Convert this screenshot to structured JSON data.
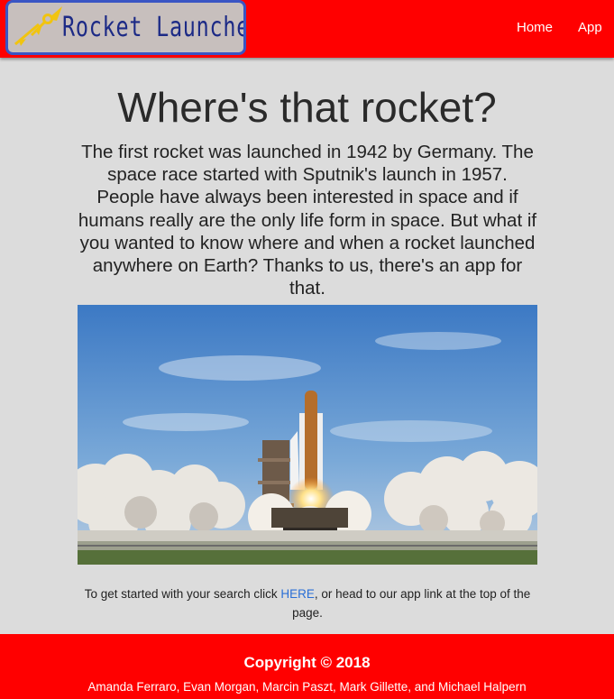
{
  "nav": {
    "logo_text": "Rocket Launcher",
    "logo_icon": "rocket-icon",
    "links": [
      {
        "label": "Home"
      },
      {
        "label": "App"
      }
    ]
  },
  "main": {
    "title": "Where's that rocket?",
    "intro": "The first rocket was launched in 1942 by Germany. The space race started with Sputnik's launch in 1957. People have always been interested in space and if humans really are the only life form in space. But what if you wanted to know where and when a rocket launched anywhere on Earth? Thanks to us, there's an app for that.",
    "image": "space-shuttle-launch-photo",
    "cta": {
      "before": "To get started with your search click ",
      "link": "HERE",
      "after": ", or head to our app link at the top of the page."
    }
  },
  "footer": {
    "copyright": "Copyright © 2018",
    "authors": "Amanda Ferraro, Evan Morgan, Marcin Paszt, Mark Gillette, and Michael Halpern"
  },
  "colors": {
    "brand": "#ff0000",
    "background": "#dcdcdc",
    "link": "#2a6fd6",
    "logo_text": "#1c2a86"
  }
}
